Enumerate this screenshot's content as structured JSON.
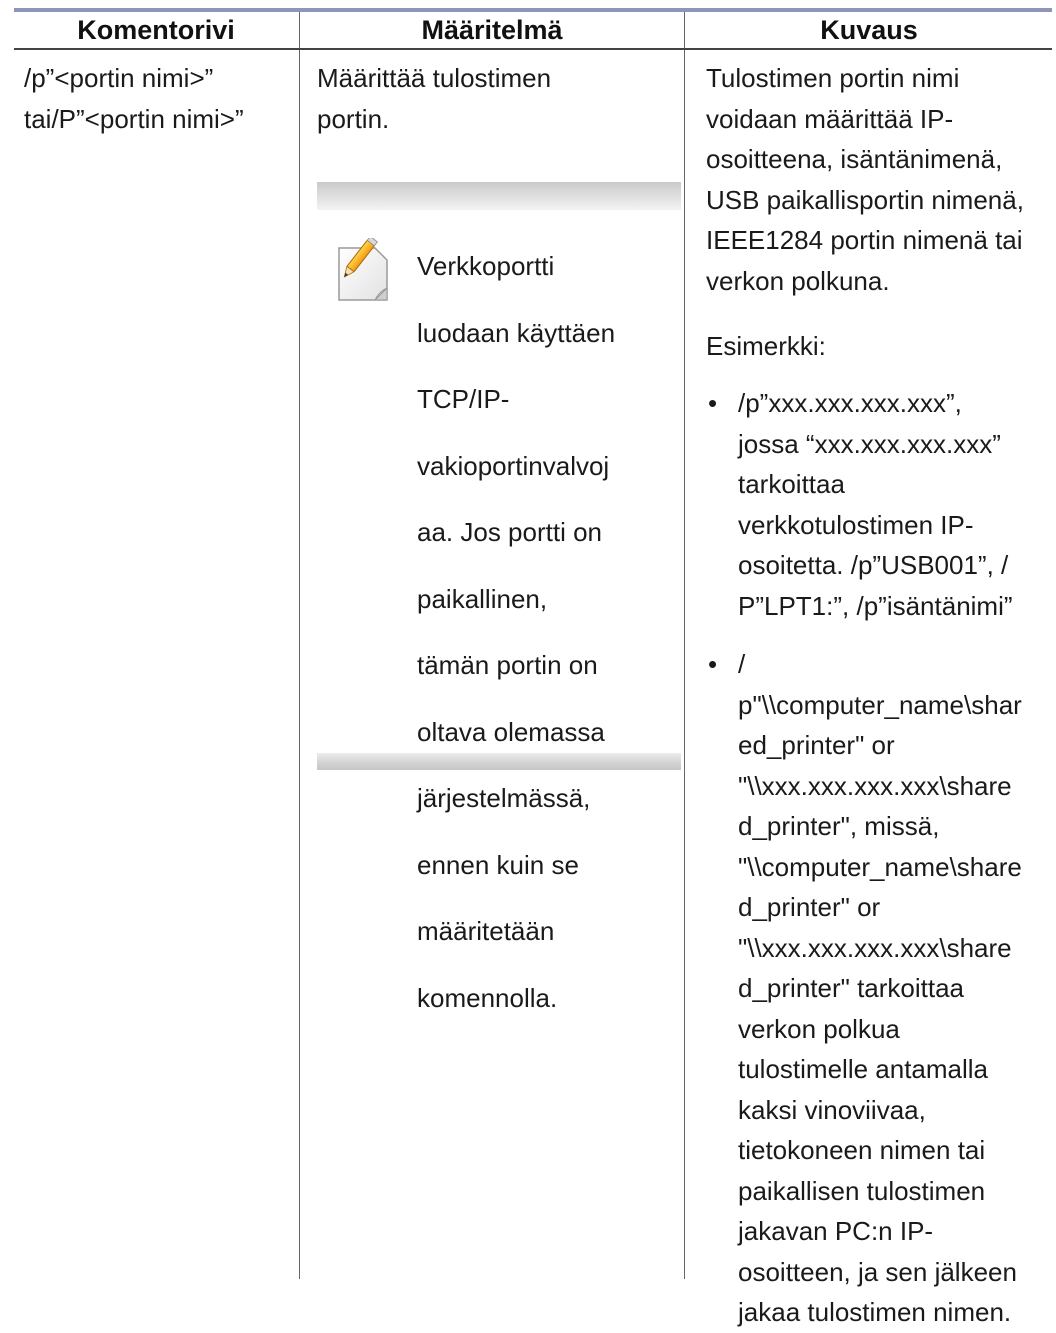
{
  "table": {
    "headers": {
      "col1": "Komentorivi",
      "col2": "Määritelmä",
      "col3": "Kuvaus"
    },
    "row": {
      "command": [
        "/p”<portin nimi>”",
        "tai/P”<portin nimi>”"
      ],
      "definition": [
        "Määrittää tulostimen",
        "portin."
      ],
      "note": {
        "icon": "note-pencil-icon",
        "lines": [
          "Verkkoportti",
          "luodaan käyttäen",
          "TCP/IP-",
          "vakioportinvalvoj",
          "aa. Jos portti on",
          "paikallinen,",
          "tämän portin on",
          "oltava olemassa",
          "järjestelmässä,",
          "ennen kuin se",
          "määritetään",
          "komennolla."
        ]
      },
      "description": {
        "intro": [
          "Tulostimen portin nimi",
          "voidaan määrittää IP-",
          "osoitteena, isäntänimenä,",
          "USB paikallisportin nimenä,",
          "IEEE1284 portin nimenä tai",
          "verkon polkuna."
        ],
        "example_label": "Esimerkki:",
        "bullet_glyph": "•",
        "bullets": [
          [
            "/p”xxx.xxx.xxx.xxx”,",
            "jossa “xxx.xxx.xxx.xxx”",
            "tarkoittaa",
            "verkkotulostimen IP-",
            "osoitetta. /p”USB001”, /",
            "P”LPT1:”, /p”isäntänimi”"
          ],
          [
            "/",
            "p\"\\\\computer_name\\shar",
            "ed_printer\" or",
            "\"\\\\xxx.xxx.xxx.xxx\\share",
            "d_printer\", missä,",
            "\"\\\\computer_name\\share",
            "d_printer\" or",
            "\"\\\\xxx.xxx.xxx.xxx\\share",
            "d_printer\" tarkoittaa",
            "verkon polkua",
            "tulostimelle antamalla",
            "kaksi vinoviivaa,",
            "tietokoneen nimen tai",
            "paikallisen tulostimen",
            "jakavan PC:n IP-",
            "osoitteen, ja sen jälkeen",
            "jakaa tulostimen nimen."
          ]
        ]
      }
    }
  }
}
